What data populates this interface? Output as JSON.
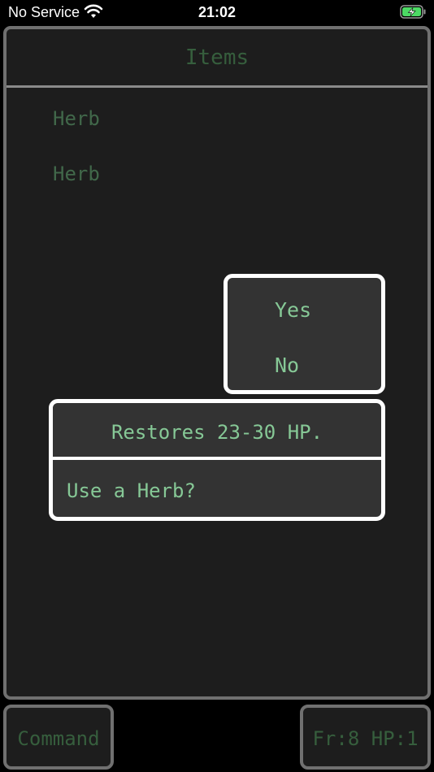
{
  "status_bar": {
    "carrier": "No Service",
    "time": "21:02",
    "wifi_icon": "wifi-icon",
    "battery_icon": "battery-charging-icon",
    "battery_color": "#4cd964"
  },
  "items_panel": {
    "title": "Items",
    "items": [
      "Herb",
      "Herb"
    ]
  },
  "confirm_menu": {
    "options": [
      "Yes",
      "No"
    ]
  },
  "message_box": {
    "description": "Restores 23-30 HP.",
    "prompt": "Use a Herb?"
  },
  "bottom": {
    "command_label": "Command",
    "stats_label": "Fr:8 HP:1"
  },
  "colors": {
    "background": "#000000",
    "panel": "#1d1d1d",
    "popup": "#333333",
    "dim_text": "#365e3d",
    "bright_text": "#86c896"
  }
}
